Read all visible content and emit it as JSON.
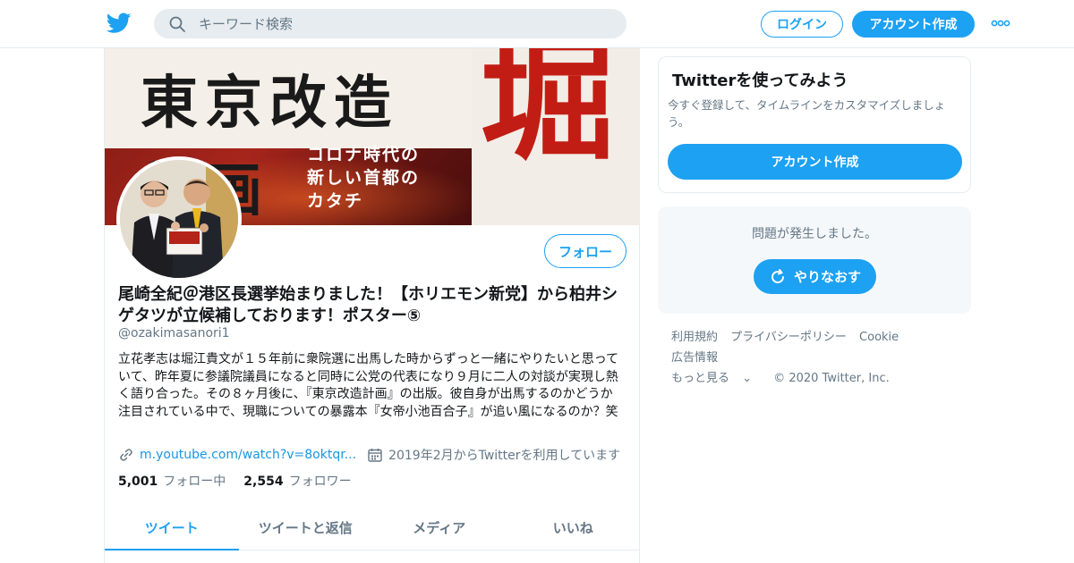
{
  "search": {
    "placeholder": "キーワード検索"
  },
  "header": {
    "login_label": "ログイン",
    "signup_label": "アカウント作成"
  },
  "banner": {
    "title_line1": "東京改造",
    "title_line2": "計画",
    "subtitle_line1": "コロナ時代の",
    "subtitle_line2": "新しい首都の",
    "subtitle_line3": "カタチ",
    "big_char": "堀"
  },
  "profile": {
    "follow_label": "フォロー",
    "name": "尾崎全紀＠港区長選挙始まりました！【ホリエモン新党】から柏井シゲタツが立候補しております！ポスター⑤",
    "handle": "@ozakimasanori1",
    "bio": "立花孝志は堀江貴文が１５年前に衆院選に出馬した時からずっと一緒にやりたいと思っていて、昨年夏に参議院議員になると同時に公党の代表になり９月に二人の対談が実現し熱く語り合った。その８ヶ月後に、『東京改造計画』の出版。彼自身が出馬するのかどうか注目されている中で、現職についての暴露本『女帝小池百合子』が追い風になるのか？笑",
    "link": "m.youtube.com/watch?v=8oktqr...",
    "joined": "2019年2月からTwitterを利用しています",
    "following_count": "5,001",
    "following_label": "フォロー中",
    "followers_count": "2,554",
    "followers_label": "フォロワー"
  },
  "tabs": [
    {
      "label": "ツイート",
      "active": true
    },
    {
      "label": "ツイートと返信",
      "active": false
    },
    {
      "label": "メディア",
      "active": false
    },
    {
      "label": "いいね",
      "active": false
    }
  ],
  "sidebar": {
    "signup_card": {
      "title": "Twitterを使ってみよう",
      "description": "今すぐ登録して、タイムラインをカスタマイズしましょう。",
      "button_label": "アカウント作成"
    },
    "error_card": {
      "message": "問題が発生しました。",
      "retry_label": "やりなおす"
    },
    "footer": {
      "links": [
        "利用規約",
        "プライバシーポリシー",
        "Cookie",
        "広告情報"
      ],
      "more_label": "もっと見る",
      "copyright": "© 2020 Twitter, Inc."
    }
  },
  "colors": {
    "accent": "#1da1f2",
    "text_primary": "#14171a",
    "text_secondary": "#657786"
  }
}
